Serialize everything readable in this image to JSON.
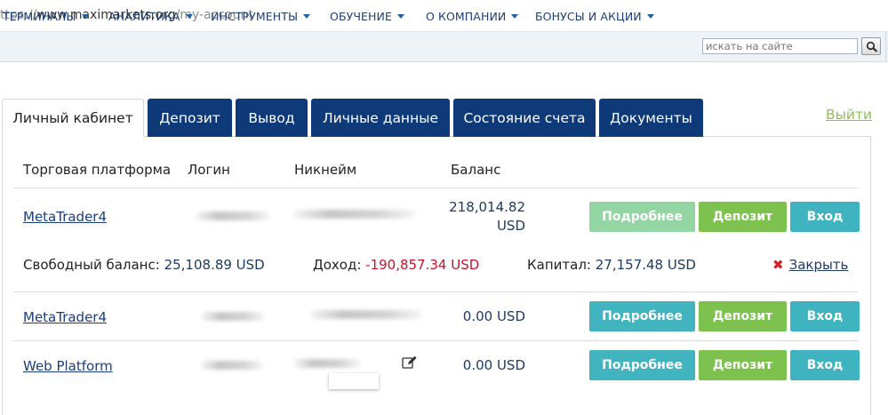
{
  "browser": {
    "url_proto": "ttps://",
    "url_host": "www.maximarkets.org",
    "url_path": "/my-account"
  },
  "nav": {
    "items": [
      "ТЕРМИНАЛЫ",
      "АНАЛИТИКА",
      "ИНСТРУМЕНТЫ",
      "ОБУЧЕНИЕ",
      "О КОМПАНИИ",
      "БОНУСЫ И АКЦИИ"
    ],
    "search_placeholder": "искать на сайте"
  },
  "tabs": [
    "Личный кабинет",
    "Депозит",
    "Вывод",
    "Личные данные",
    "Состояние счета",
    "Документы"
  ],
  "logout_label": "Выйти",
  "table": {
    "headers": [
      "Торговая платформа",
      "Логин",
      "Никнейм",
      "Баланс"
    ],
    "rows": [
      {
        "platform": "MetaTrader4",
        "balance_line1": "218,014.82",
        "balance_line2": "USD"
      },
      {
        "platform": "MetaTrader4",
        "balance": "0.00 USD"
      },
      {
        "platform": "Web Platform",
        "balance": "0.00 USD"
      }
    ],
    "buttons": {
      "more": "Подробнее",
      "deposit": "Депозит",
      "login": "Вход"
    }
  },
  "details": {
    "free_balance_label": "Свободный баланс:",
    "free_balance_value": "25,108.89 USD",
    "income_label": "Доход:",
    "income_value": "-190,857.34 USD",
    "capital_label": "Капитал:",
    "capital_value": "27,157.48 USD",
    "close_label": "Закрыть"
  },
  "colors": {
    "nav_text": "#1f3f70",
    "tab_dark": "#0f3a7a",
    "button_teal": "#41b4bf",
    "button_green": "#7dc24f",
    "negative": "#c8102e",
    "logout": "#8cc152"
  }
}
